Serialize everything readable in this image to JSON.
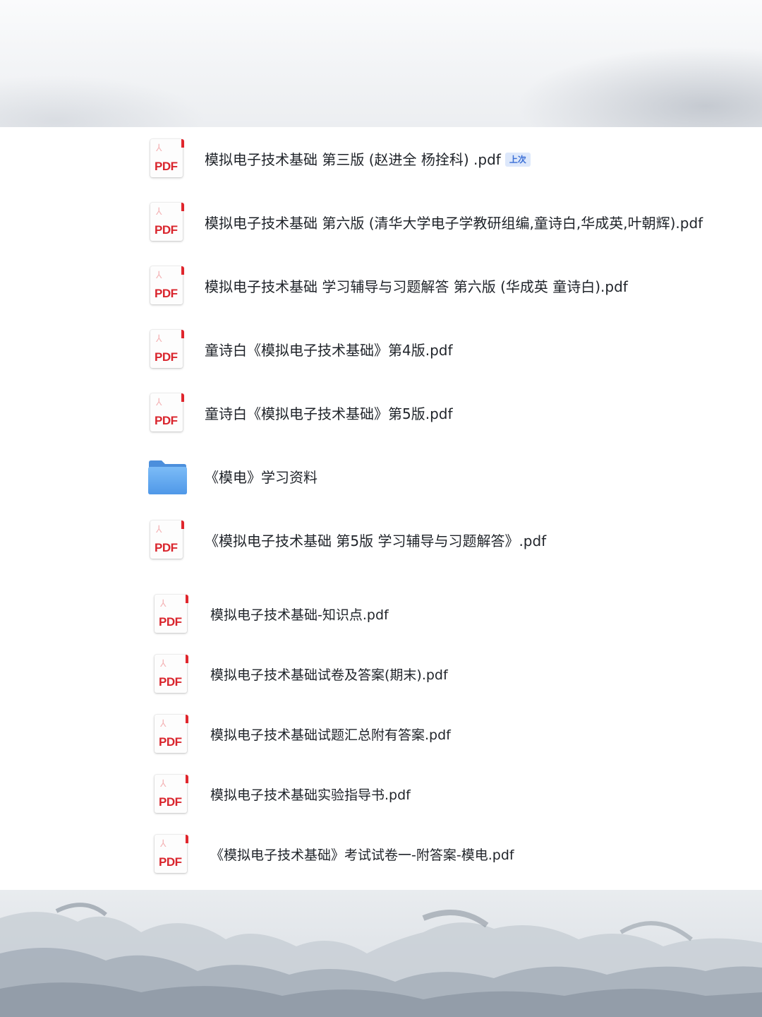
{
  "files": [
    {
      "type": "pdf",
      "name": "模拟电子技术基础 第三版 (赵进全 杨拴科) .pdf",
      "badge": "上次"
    },
    {
      "type": "pdf",
      "name": "模拟电子技术基础 第六版 (清华大学电子学教研组编,童诗白,华成英,叶朝辉).pdf"
    },
    {
      "type": "pdf",
      "name": "模拟电子技术基础 学习辅导与习题解答 第六版 (华成英 童诗白).pdf"
    },
    {
      "type": "pdf",
      "name": "童诗白《模拟电子技术基础》第4版.pdf"
    },
    {
      "type": "pdf",
      "name": "童诗白《模拟电子技术基础》第5版.pdf"
    },
    {
      "type": "folder",
      "name": "《模电》学习资料"
    },
    {
      "type": "pdf",
      "name": "《模拟电子技术基础 第5版 学习辅导与习题解答》.pdf"
    },
    {
      "type": "pdf",
      "name": "模拟电子技术基础-知识点.pdf"
    },
    {
      "type": "pdf",
      "name": "模拟电子技术基础试卷及答案(期末).pdf"
    },
    {
      "type": "pdf",
      "name": "模拟电子技术基础试题汇总附有答案.pdf"
    },
    {
      "type": "pdf",
      "name": "模拟电子技术基础实验指导书.pdf"
    },
    {
      "type": "pdf",
      "name": "《模拟电子技术基础》考试试卷一-附答案-模电.pdf"
    }
  ],
  "icon_labels": {
    "pdf": "PDF"
  },
  "icons": {
    "pdf": "pdf-file-icon",
    "folder": "folder-icon"
  },
  "colors": {
    "pdf_red": "#d9252d",
    "folder_blue": "#5aa6f0",
    "badge_text": "#3b6fd6",
    "badge_bg": "#dde8fb",
    "text": "#1f2329"
  }
}
